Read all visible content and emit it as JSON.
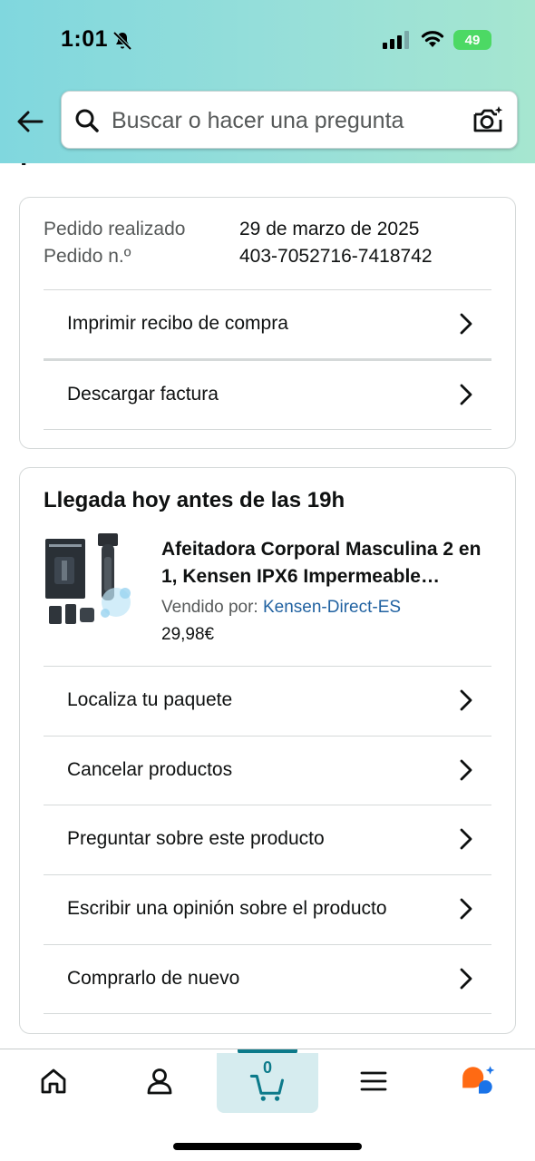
{
  "status_bar": {
    "time": "1:01",
    "battery": "49"
  },
  "header": {
    "search_placeholder": "Buscar o hacer una pregunta",
    "icons": {
      "back": "back-arrow-icon",
      "search": "search-icon",
      "camera": "camera-search-icon"
    }
  },
  "page_title_partial": "pedido",
  "order": {
    "date_label": "Pedido realizado",
    "date_value": "29 de marzo de 2025",
    "number_label": "Pedido n.º",
    "number_value": "403-7052716-7418742",
    "actions": [
      "Imprimir recibo de compra",
      "Descargar factura"
    ]
  },
  "shipment": {
    "arrival": "Llegada hoy antes de las 19h",
    "product": {
      "title": "Afeitadora Corporal Masculina 2 en 1, Kensen IPX6 Impermeable Recortadora Corporal",
      "sold_by_label": "Vendido por:",
      "seller": "Kensen-Direct-ES",
      "price": "29,98€"
    },
    "actions": [
      "Localiza tu paquete",
      "Cancelar productos",
      "Preguntar sobre este producto",
      "Escribir una opinión sobre el producto",
      "Comprarlo de nuevo"
    ]
  },
  "bottom_nav": {
    "cart_count": "0",
    "items": [
      "home-icon",
      "account-icon",
      "cart-icon",
      "menu-icon",
      "rufus-ai-icon"
    ]
  },
  "colors": {
    "header_gradient_start": "#80d7de",
    "header_gradient_end": "#a6e6d0",
    "link": "#2162a1",
    "cart_accent": "#0c7a8a"
  }
}
